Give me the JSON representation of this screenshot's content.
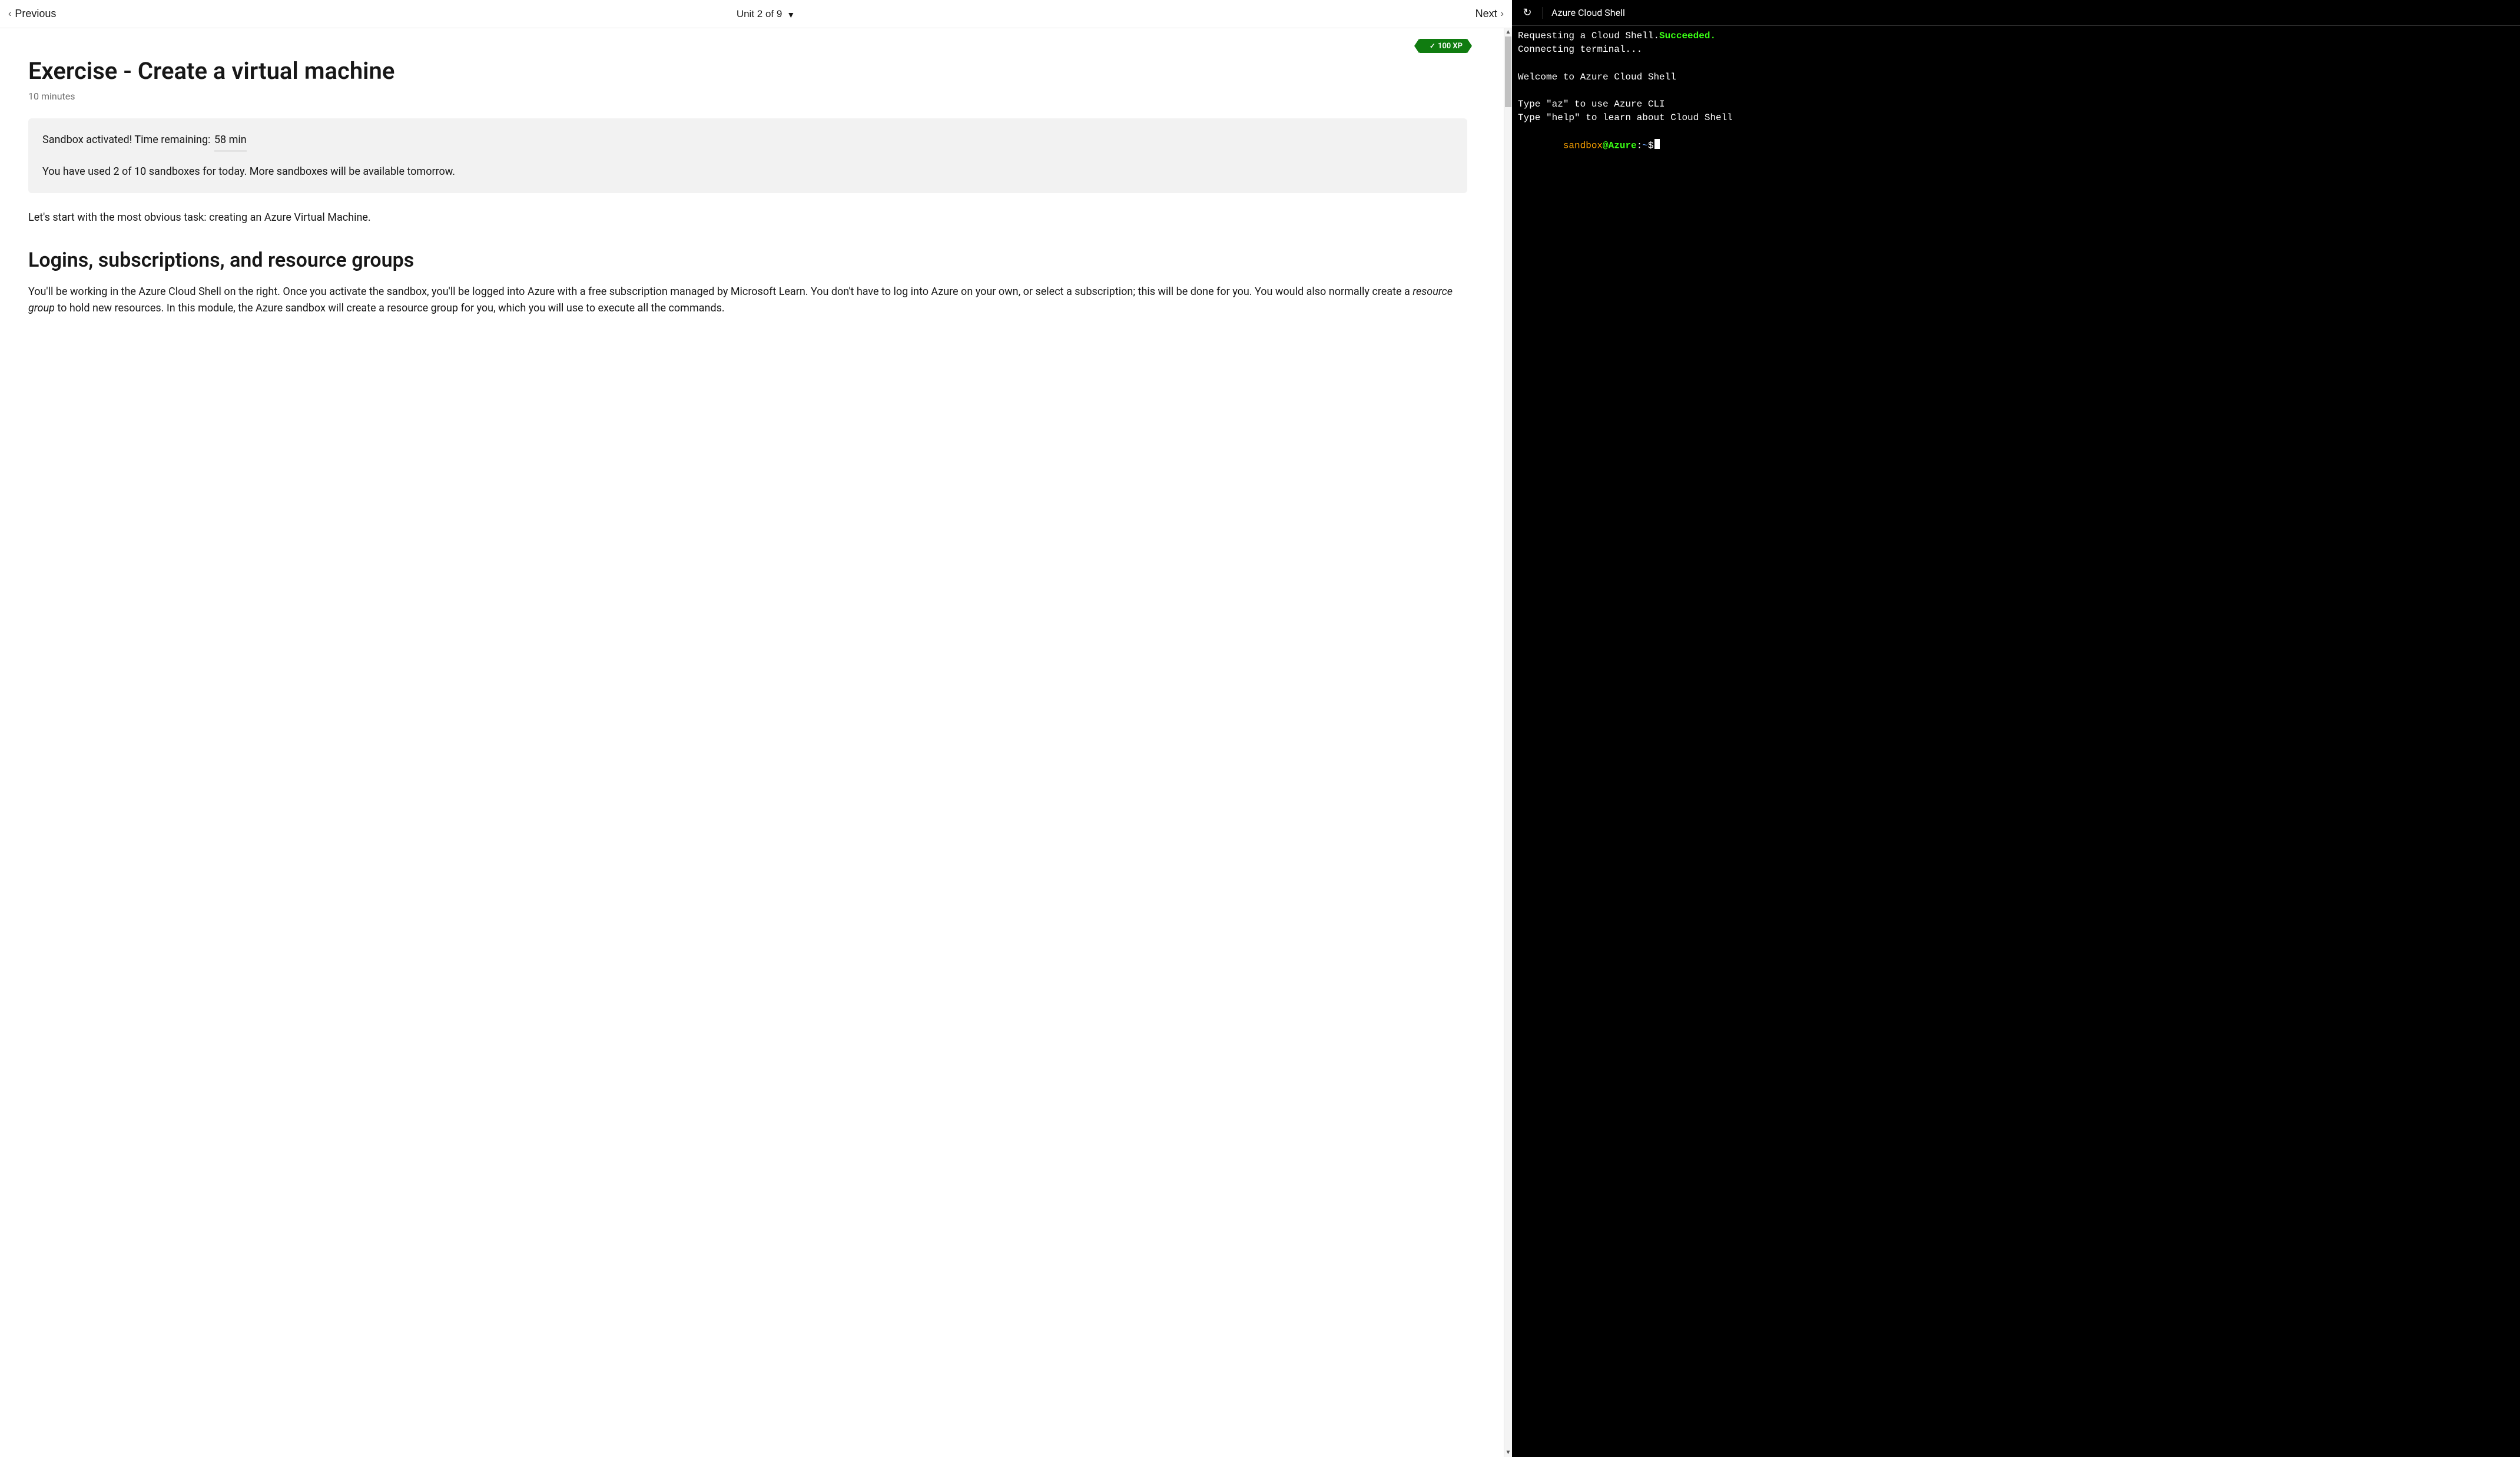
{
  "topnav": {
    "previous_label": "Previous",
    "unit_label": "Unit 2 of 9",
    "next_label": "Next"
  },
  "xp": {
    "label": "100 XP"
  },
  "page": {
    "title": "Exercise - Create a virtual machine",
    "duration": "10 minutes"
  },
  "sandbox": {
    "activated_prefix": "Sandbox activated! Time remaining:",
    "time_remaining": "58 min",
    "usage_line": "You have used 2 of 10 sandboxes for today. More sandboxes will be available tomorrow."
  },
  "body": {
    "intro": "Let's start with the most obvious task: creating an Azure Virtual Machine.",
    "section1_title": "Logins, subscriptions, and resource groups",
    "section1_p1_a": "You'll be working in the Azure Cloud Shell on the right. Once you activate the sandbox, you'll be logged into Azure with a free subscription managed by Microsoft Learn. You don't have to log into Azure on your own, or select a subscription; this will be done for you. You would also normally create a ",
    "section1_p1_em": "resource group",
    "section1_p1_b": " to hold new resources. In this module, the Azure sandbox will create a resource group for you, which you will use to execute all the commands."
  },
  "shell": {
    "title": "Azure Cloud Shell",
    "line1_a": "Requesting a Cloud Shell.",
    "line1_b": "Succeeded.",
    "line2": "Connecting terminal...",
    "blank": "",
    "line3": "Welcome to Azure Cloud Shell",
    "line4": "Type \"az\" to use Azure CLI",
    "line5": "Type \"help\" to learn about Cloud Shell",
    "prompt_indent": "        ",
    "prompt_user": "sandbox",
    "prompt_at": "@",
    "prompt_host": "Azure",
    "prompt_colon": ":",
    "prompt_tilde": "~",
    "prompt_cash": "$"
  }
}
